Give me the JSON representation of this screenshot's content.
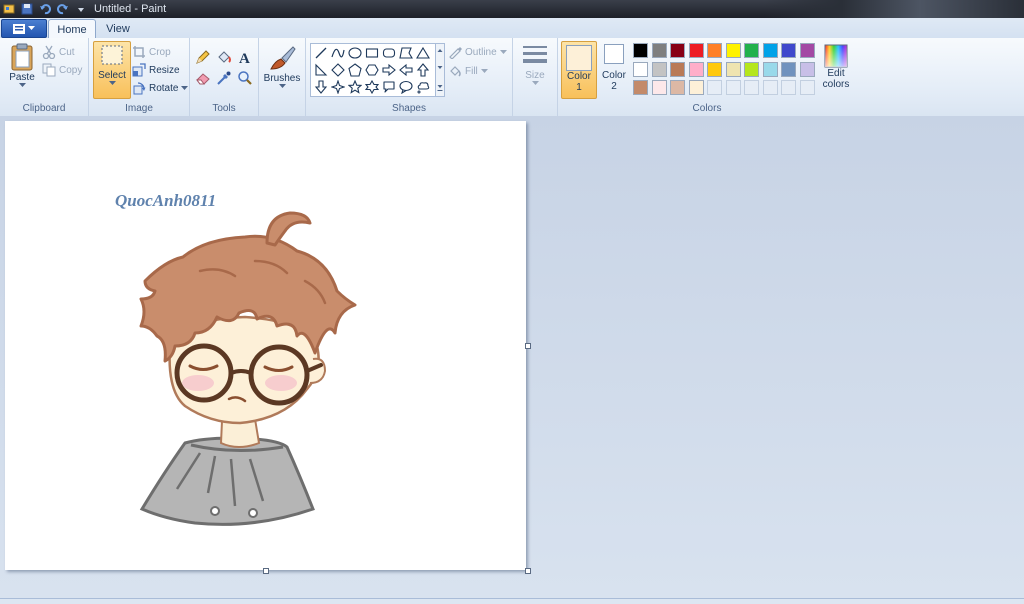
{
  "window": {
    "title": "Untitled - Paint"
  },
  "tabs": [
    {
      "label": "Home"
    },
    {
      "label": "View"
    }
  ],
  "clipboard": {
    "paste": "Paste",
    "cut": "Cut",
    "copy": "Copy",
    "label": "Clipboard"
  },
  "image": {
    "select": "Select",
    "crop": "Crop",
    "resize": "Resize",
    "rotate": "Rotate",
    "label": "Image"
  },
  "tools": {
    "label": "Tools"
  },
  "brushes": {
    "label": "Brushes"
  },
  "shapes": {
    "outline": "Outline",
    "fill": "Fill",
    "label": "Shapes"
  },
  "size": {
    "label": "Size"
  },
  "colors": {
    "color1_label": "Color",
    "color1_num": "1",
    "color2_label": "Color",
    "color2_num": "2",
    "color1_value": "#fdf0d8",
    "color2_value": "#ffffff",
    "edit_label_1": "Edit",
    "edit_label_2": "colors",
    "label": "Colors",
    "palette_row1": [
      "#000000",
      "#7f7f7f",
      "#880015",
      "#ed1c24",
      "#ff7f27",
      "#fff200",
      "#22b14c",
      "#00a2e8",
      "#3f48cc",
      "#a349a4"
    ],
    "palette_row2": [
      "#ffffff",
      "#c3c3c3",
      "#b97a57",
      "#ffaec9",
      "#ffc90e",
      "#efe4b0",
      "#b5e61d",
      "#99d9ea",
      "#7092be",
      "#c8bfe7"
    ],
    "palette_row3": [
      "#c38a6a",
      "#fde8ea",
      "#dcb8a5",
      "#fdf0d8"
    ]
  },
  "canvas": {
    "signature": "QuocAnh0811"
  }
}
